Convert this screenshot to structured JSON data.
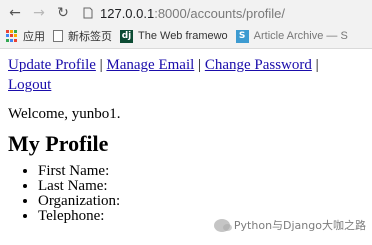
{
  "browser": {
    "url_host": "127.0.0.1",
    "url_rest": ":8000/accounts/profile/",
    "bookmarks": [
      {
        "icon": "apps-icon",
        "label": "应用"
      },
      {
        "icon": "page-icon",
        "label": "新标签页"
      },
      {
        "icon": "django-icon",
        "label": "The Web framewo"
      },
      {
        "icon": "s-icon",
        "label": "Article Archive — S"
      }
    ]
  },
  "nav": {
    "update_profile": "Update Profile",
    "manage_email": "Manage Email",
    "change_password": "Change Password",
    "logout": "Logout",
    "separator": "|"
  },
  "welcome": "Welcome, yunbo1.",
  "heading": "My Profile",
  "fields": [
    "First Name:",
    "Last Name:",
    "Organization:",
    "Telephone:"
  ],
  "watermark": "Python与Django大咖之路",
  "colors": {
    "link": "#1a0dab"
  }
}
